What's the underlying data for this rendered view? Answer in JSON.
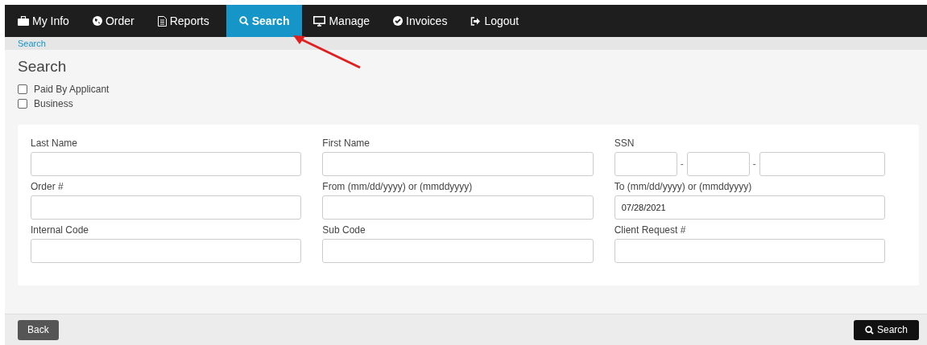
{
  "nav": [
    {
      "label": "My Info",
      "selected": false
    },
    {
      "label": "Order",
      "selected": false
    },
    {
      "label": "Reports",
      "selected": false
    },
    {
      "label": "Search",
      "selected": true
    },
    {
      "label": "Manage",
      "selected": false
    },
    {
      "label": "Invoices",
      "selected": false
    },
    {
      "label": "Logout",
      "selected": false
    }
  ],
  "breadcrumb": "Search",
  "title": "Search",
  "checkboxes": [
    {
      "label": "Paid By Applicant",
      "checked": false
    },
    {
      "label": "Business",
      "checked": false
    }
  ],
  "fields": [
    {
      "label": "Last Name",
      "kind": "text"
    },
    {
      "label": "First Name",
      "kind": "text"
    },
    {
      "label": "SSN",
      "kind": "ssn",
      "separators": [
        "-",
        "-"
      ]
    },
    {
      "label": "Order #",
      "kind": "text"
    },
    {
      "label": "From (mm/dd/yyyy) or (mmddyyyy)",
      "kind": "text"
    },
    {
      "label": "To (mm/dd/yyyy) or (mmddyyyy)",
      "kind": "text",
      "value": "07/28/2021"
    },
    {
      "label": "Internal Code",
      "kind": "text"
    },
    {
      "label": "Sub Code",
      "kind": "text"
    },
    {
      "label": "Client Request #",
      "kind": "text"
    }
  ],
  "footer": {
    "back": "Back",
    "search": "Search"
  }
}
